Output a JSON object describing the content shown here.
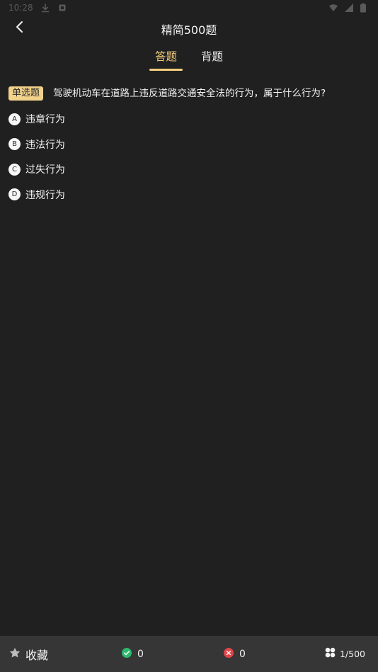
{
  "status_bar": {
    "time": "10:28"
  },
  "header": {
    "title": "精简500题"
  },
  "tabs": [
    {
      "label": "答题",
      "active": true
    },
    {
      "label": "背题",
      "active": false
    }
  ],
  "question": {
    "type_label": "单选题",
    "text": "驾驶机动车在道路上违反道路交通安全法的行为，属于什么行为?",
    "options": [
      {
        "key": "A",
        "text": "违章行为"
      },
      {
        "key": "B",
        "text": "违法行为"
      },
      {
        "key": "C",
        "text": "过失行为"
      },
      {
        "key": "D",
        "text": "违规行为"
      }
    ]
  },
  "bottom_bar": {
    "favorite_label": "收藏",
    "correct_count": "0",
    "wrong_count": "0",
    "progress": "1/500"
  },
  "colors": {
    "background": "#202020",
    "accent": "#f5ce7c",
    "type_badge": "#f2d28b",
    "correct": "#2db86e",
    "wrong": "#e0454a",
    "bottom_bar": "#363636"
  },
  "icons": {
    "back": "chevron-left-icon",
    "favorite": "star-icon",
    "correct": "check-circle-icon",
    "wrong": "x-circle-icon",
    "progress": "grid-icon"
  }
}
